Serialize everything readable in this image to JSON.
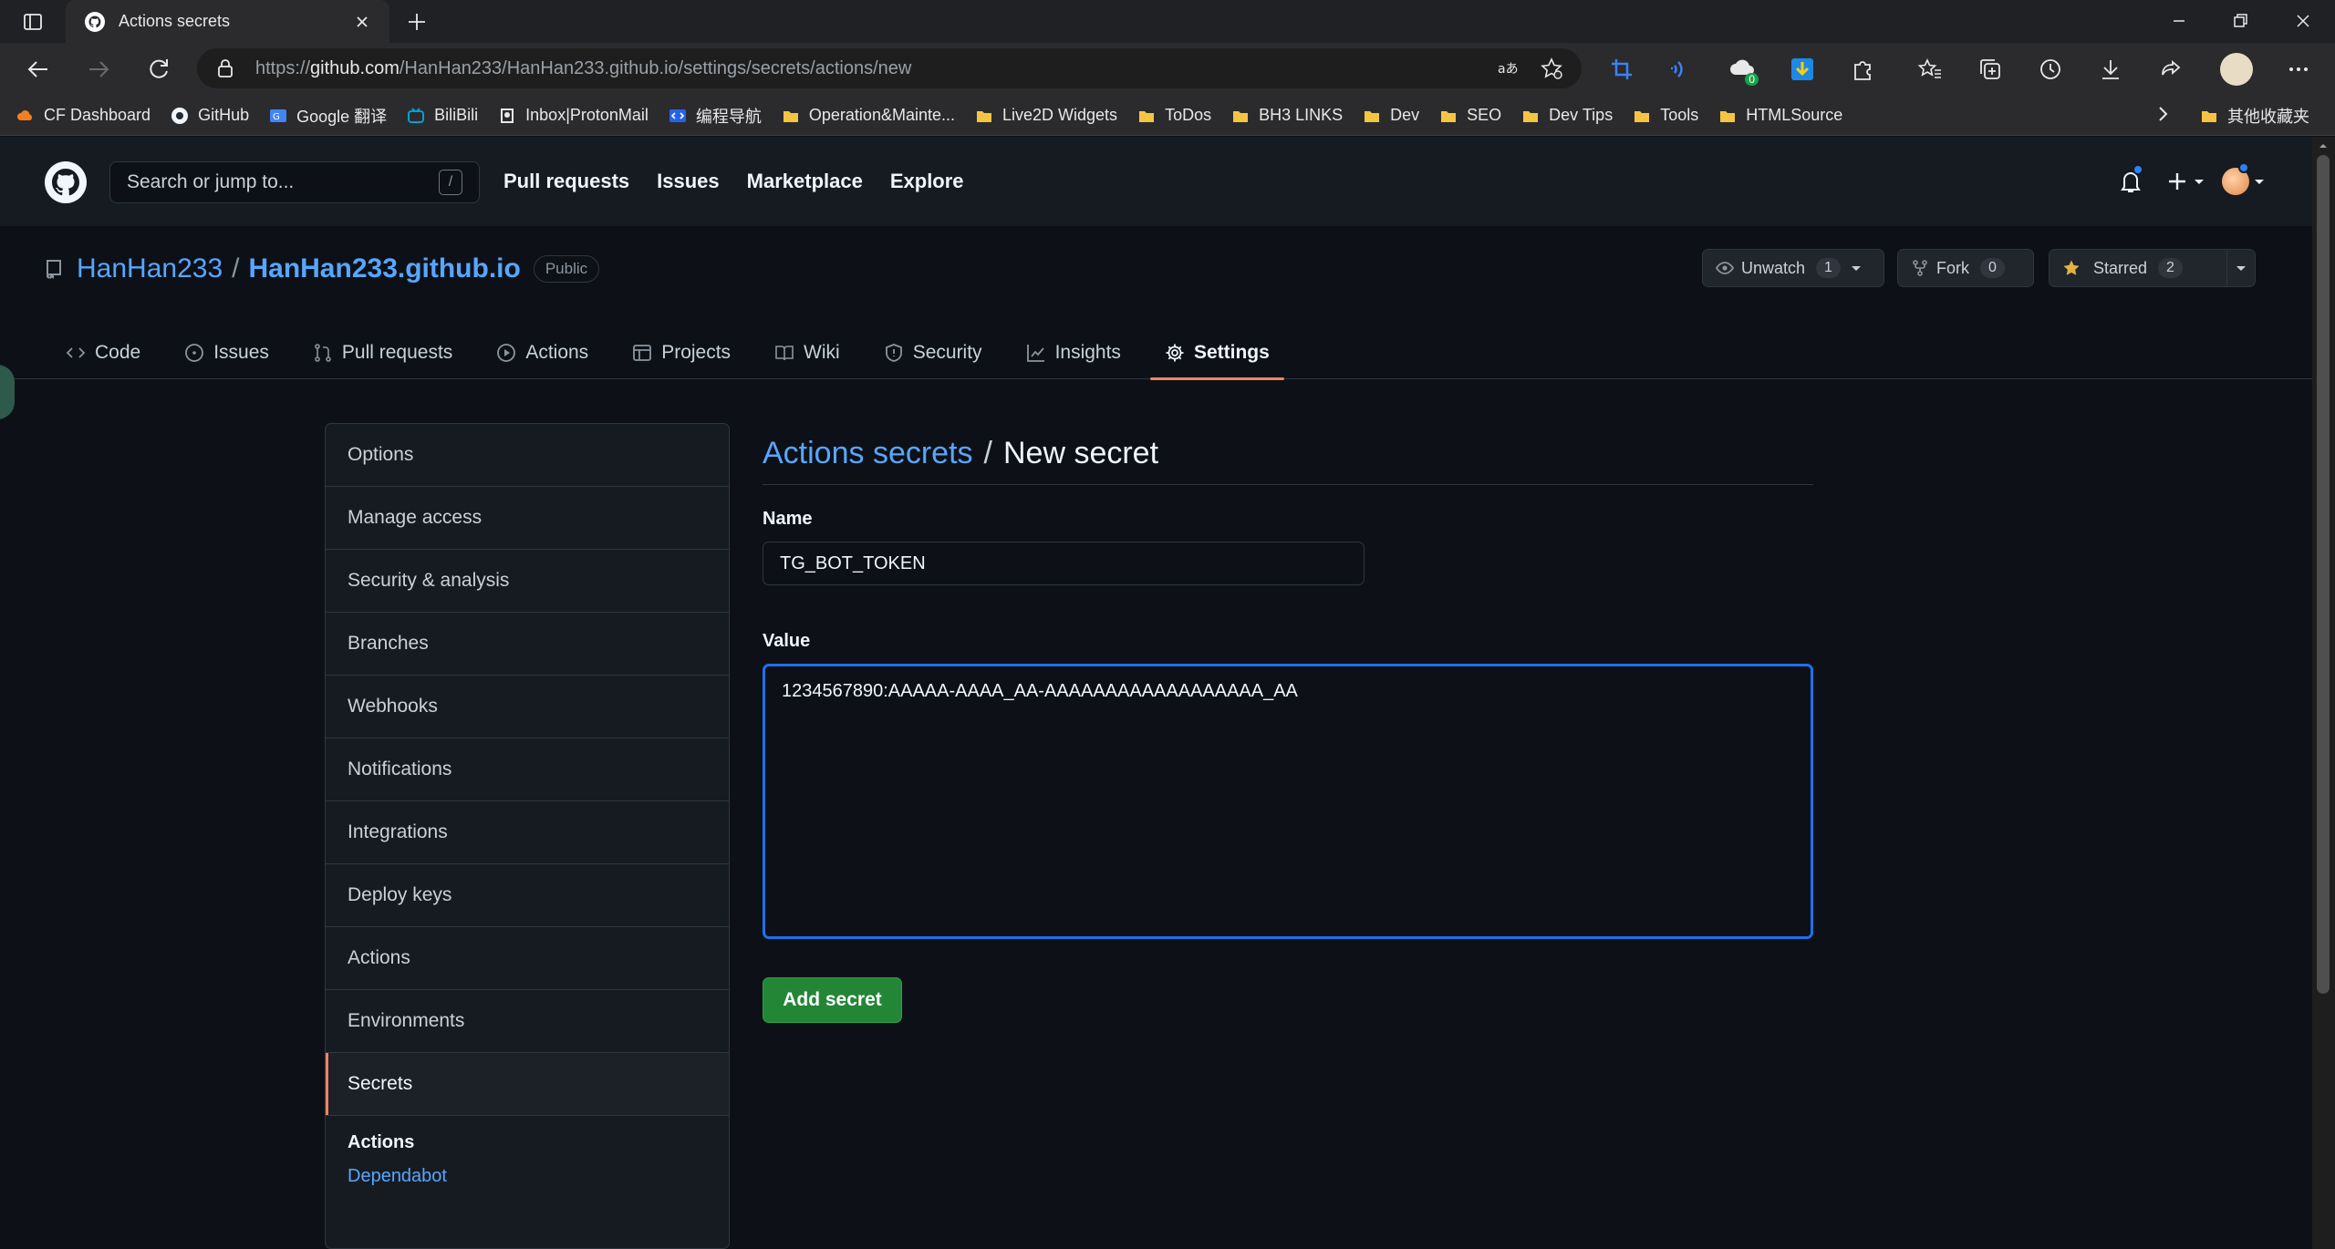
{
  "browser": {
    "tab_title": "Actions secrets",
    "url_prefix": "https://",
    "url_host": "github.com",
    "url_path": "/HanHan233/HanHan233.github.io/settings/secrets/actions/new",
    "ext_badge": "0",
    "bookmarks": [
      {
        "label": "CF Dashboard",
        "icon": "cloud-icon"
      },
      {
        "label": "GitHub",
        "icon": "github-icon"
      },
      {
        "label": "Google 翻译",
        "icon": "translate-icon"
      },
      {
        "label": "BiliBili",
        "icon": "tv-icon"
      },
      {
        "label": "Inbox|ProtonMail",
        "icon": "mail-icon"
      },
      {
        "label": "编程导航",
        "icon": "code-icon"
      },
      {
        "label": "Operation&Mainte...",
        "icon": "folder-icon"
      },
      {
        "label": "Live2D Widgets",
        "icon": "folder-icon"
      },
      {
        "label": "ToDos",
        "icon": "folder-icon"
      },
      {
        "label": "BH3 LINKS",
        "icon": "folder-icon"
      },
      {
        "label": "Dev",
        "icon": "folder-icon"
      },
      {
        "label": "SEO",
        "icon": "folder-icon"
      },
      {
        "label": "Dev Tips",
        "icon": "folder-icon"
      },
      {
        "label": "Tools",
        "icon": "folder-icon"
      },
      {
        "label": "HTMLSource",
        "icon": "folder-icon"
      }
    ],
    "other_bookmarks": "其他收藏夹"
  },
  "gh": {
    "search_placeholder": "Search or jump to...",
    "search_key": "/",
    "nav": [
      "Pull requests",
      "Issues",
      "Marketplace",
      "Explore"
    ]
  },
  "repo": {
    "owner": "HanHan233",
    "sep": "/",
    "name": "HanHan233.github.io",
    "visibility": "Public",
    "unwatch_label": "Unwatch",
    "unwatch_count": "1",
    "fork_label": "Fork",
    "fork_count": "0",
    "star_label": "Starred",
    "star_count": "2",
    "tabs": [
      {
        "label": "Code",
        "icon": "code-icon"
      },
      {
        "label": "Issues",
        "icon": "issue-icon"
      },
      {
        "label": "Pull requests",
        "icon": "pull-request-icon"
      },
      {
        "label": "Actions",
        "icon": "play-icon"
      },
      {
        "label": "Projects",
        "icon": "table-icon"
      },
      {
        "label": "Wiki",
        "icon": "book-icon"
      },
      {
        "label": "Security",
        "icon": "shield-icon"
      },
      {
        "label": "Insights",
        "icon": "graph-icon"
      },
      {
        "label": "Settings",
        "icon": "gear-icon"
      }
    ],
    "active_tab": "Settings"
  },
  "sidebar": {
    "items": [
      "Options",
      "Manage access",
      "Security & analysis",
      "Branches",
      "Webhooks",
      "Notifications",
      "Integrations",
      "Deploy keys",
      "Actions",
      "Environments",
      "Secrets"
    ],
    "active": "Secrets",
    "section_heading": "Actions",
    "section_link": "Dependabot"
  },
  "form": {
    "crumb": "Actions secrets",
    "sep": "/",
    "title": "New secret",
    "name_label": "Name",
    "name_value": "TG_BOT_TOKEN",
    "value_label": "Value",
    "value_value": "1234567890:AAAAA-AAAA_AA-AAAAAAAAAAAAAAAAAA_AA",
    "submit": "Add secret"
  },
  "colors": {
    "accent_blue": "#58a6ff",
    "tab_underline": "#f78166",
    "button_green": "#238636",
    "focus_border": "#1f6feb"
  }
}
